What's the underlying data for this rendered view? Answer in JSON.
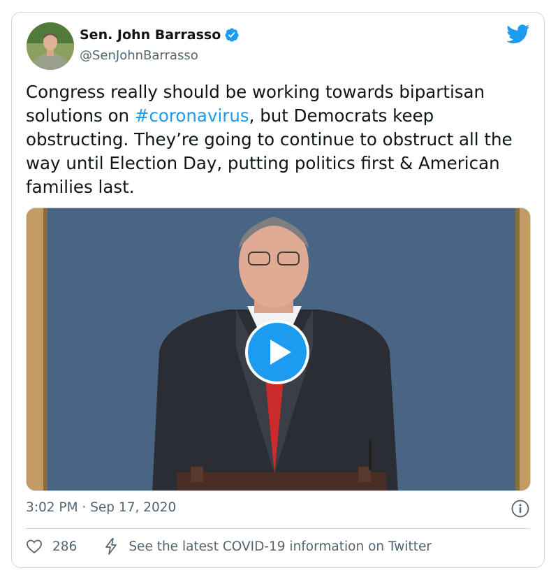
{
  "author": {
    "name": "Sen. John Barrasso",
    "handle": "@SenJohnBarrasso"
  },
  "tweet": {
    "text_before": "Congress really should be working towards bipartisan solutions on ",
    "hashtag": "#coronavirus",
    "text_after": ", but Democrats keep obstructing. They’re going to continue to obstruct all the way until Election Day, putting politics first & American families last.",
    "timestamp": "3:02 PM · Sep 17, 2020",
    "likes": "286",
    "covid_link": "See the latest COVID-19 information on Twitter"
  },
  "icons": {
    "brand": "twitter-bird-icon",
    "verified": "verified-badge-icon",
    "play": "play-icon",
    "info": "info-icon",
    "like": "heart-icon",
    "covid": "lightning-bolt-icon"
  },
  "colors": {
    "accent": "#1d9bf0",
    "text": "#0f1419",
    "secondary": "#536471",
    "border": "#cfd9de",
    "stage_backdrop": "#4a6584",
    "tie": "#cc2b2b"
  }
}
